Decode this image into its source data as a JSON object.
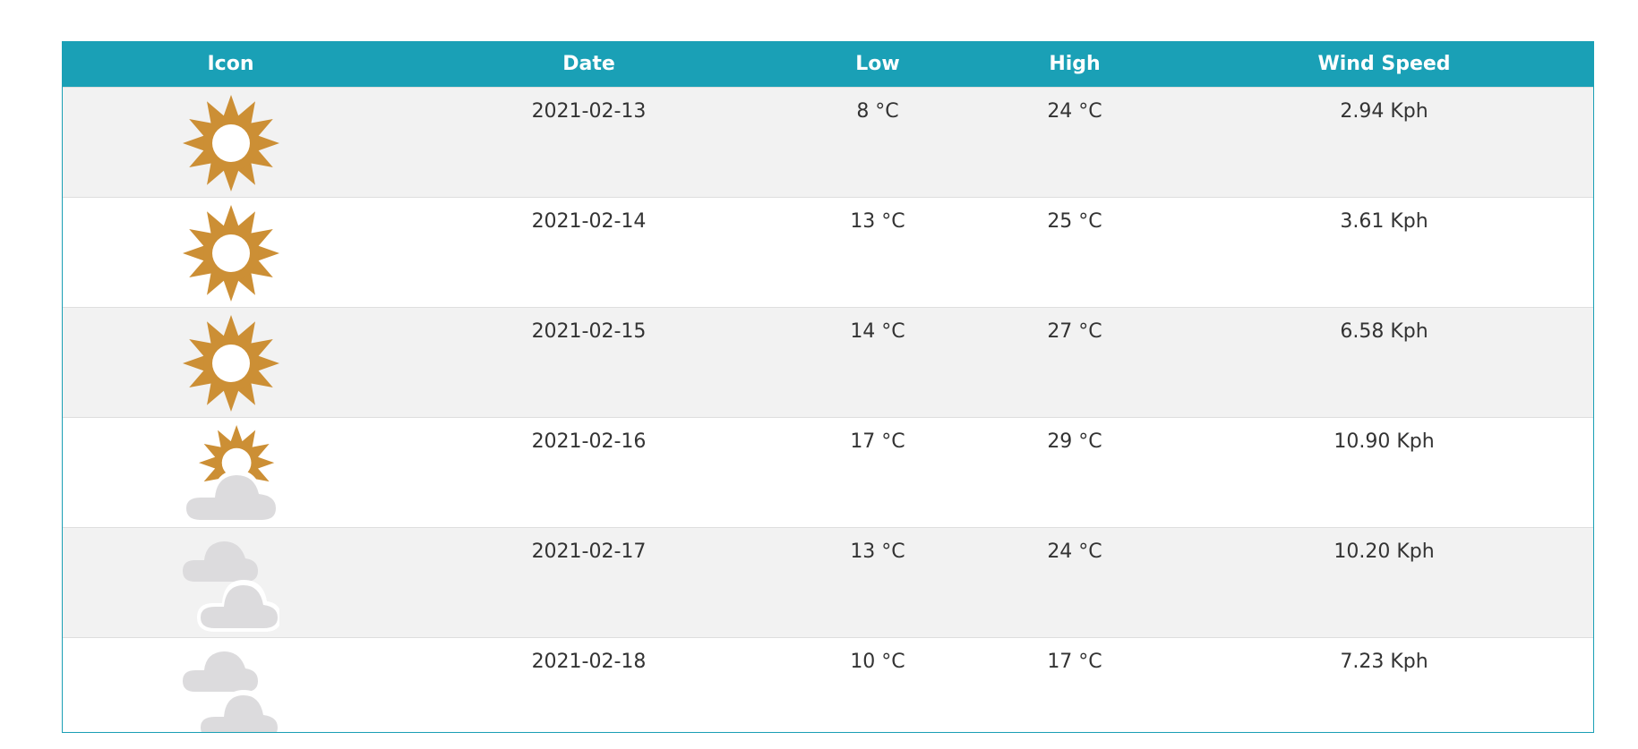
{
  "table": {
    "headers": {
      "icon": "Icon",
      "date": "Date",
      "low": "Low",
      "high": "High",
      "wind": "Wind Speed"
    },
    "rows": [
      {
        "icon": "sun-icon",
        "date": "2021-02-13",
        "low": "8 °C",
        "high": "24 °C",
        "wind": "2.94 Kph"
      },
      {
        "icon": "sun-icon",
        "date": "2021-02-14",
        "low": "13 °C",
        "high": "25 °C",
        "wind": "3.61 Kph"
      },
      {
        "icon": "sun-icon",
        "date": "2021-02-15",
        "low": "14 °C",
        "high": "27 °C",
        "wind": "6.58 Kph"
      },
      {
        "icon": "partly-cloudy-icon",
        "date": "2021-02-16",
        "low": "17 °C",
        "high": "29 °C",
        "wind": "10.90 Kph"
      },
      {
        "icon": "cloudy-icon",
        "date": "2021-02-17",
        "low": "13 °C",
        "high": "24 °C",
        "wind": "10.20 Kph"
      },
      {
        "icon": "cloudy-icon",
        "date": "2021-02-18",
        "low": "10 °C",
        "high": "17 °C",
        "wind": "7.23 Kph"
      }
    ]
  },
  "colors": {
    "header_bg": "#1aa0b6",
    "header_text": "#ffffff",
    "row_stripe": "#f2f2f2",
    "sun": "#cc8f35",
    "cloud": "#dcdbdd"
  }
}
